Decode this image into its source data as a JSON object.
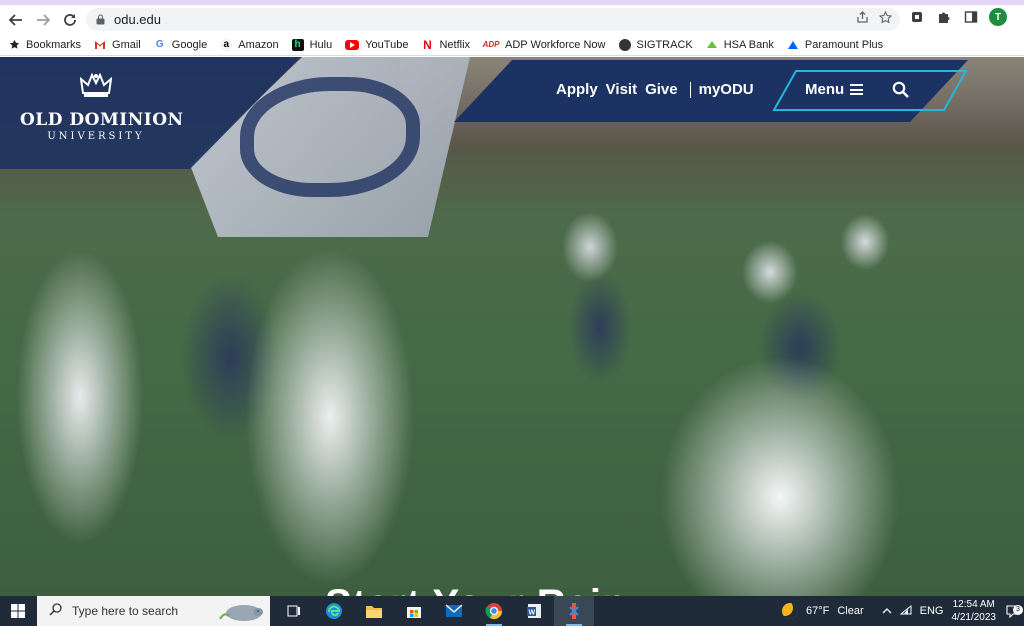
{
  "browser": {
    "url": "odu.edu",
    "bookmarks": [
      {
        "label": "Bookmarks",
        "icon": "star-icon"
      },
      {
        "label": "Gmail",
        "icon": "gmail-icon"
      },
      {
        "label": "Google",
        "icon": "google-icon"
      },
      {
        "label": "Amazon",
        "icon": "amazon-icon"
      },
      {
        "label": "Hulu",
        "icon": "hulu-icon"
      },
      {
        "label": "YouTube",
        "icon": "youtube-icon"
      },
      {
        "label": "Netflix",
        "icon": "netflix-icon"
      },
      {
        "label": "ADP Workforce Now",
        "icon": "adp-icon"
      },
      {
        "label": "SIGTRACK",
        "icon": "sigtrack-icon"
      },
      {
        "label": "HSA Bank",
        "icon": "hsa-bank-icon"
      },
      {
        "label": "Paramount Plus",
        "icon": "paramount-icon"
      }
    ],
    "profile_initial": "T"
  },
  "site": {
    "logo": {
      "name": "OLD DOMINION",
      "sub": "UNIVERSITY"
    },
    "nav": {
      "apply": "Apply",
      "visit": "Visit",
      "give": "Give",
      "myodu": "myODU",
      "menu": "Menu"
    },
    "hero_text": "Start Your Rein",
    "colors": {
      "navy": "#1b3262",
      "accent": "#22b6e0"
    }
  },
  "taskbar": {
    "search_placeholder": "Type here to search",
    "apps": [
      "task-view-icon",
      "edge-icon",
      "file-explorer-icon",
      "microsoft-store-icon",
      "mail-icon",
      "chrome-icon",
      "word-icon",
      "snipping-tool-icon"
    ],
    "weather": {
      "temp": "67°F",
      "condition": "Clear"
    },
    "language": "ENG",
    "time": "12:54 AM",
    "date": "4/21/2023",
    "notification_count": "3"
  }
}
